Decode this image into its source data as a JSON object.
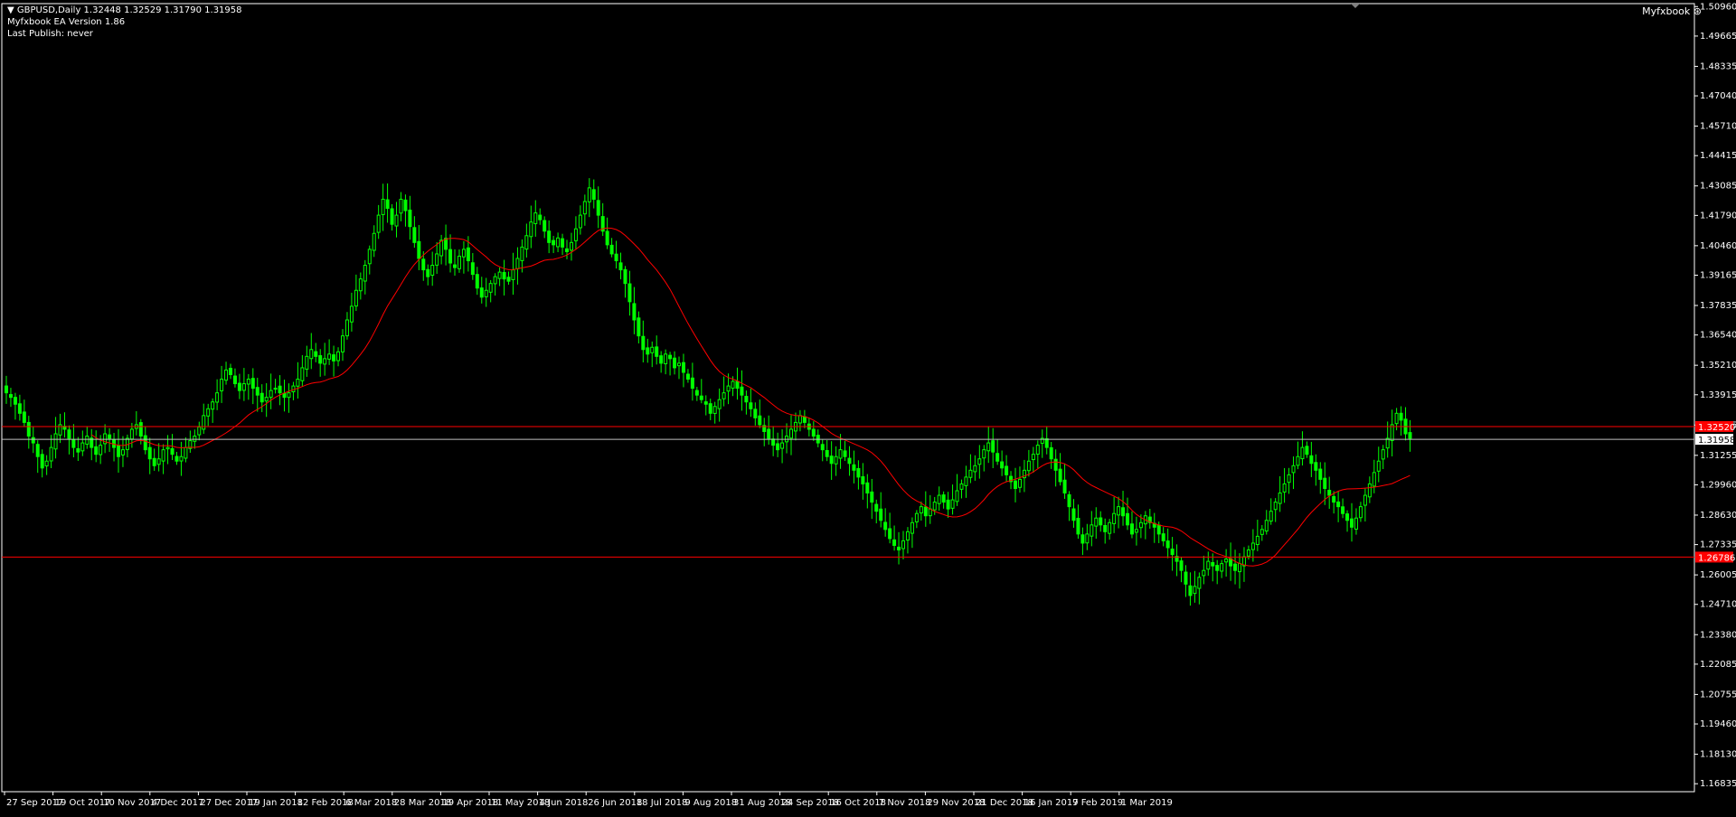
{
  "header": {
    "symbol_line": "GBPUSD,Daily  1.32448 1.32529 1.31790 1.31958",
    "ea_version": "Myfxbook EA Version 1.86",
    "last_publish": "Last Publish: never",
    "brand": "Myfxbook"
  },
  "colors": {
    "background": "#000000",
    "bull_candle": "#00ff00",
    "bear_candle": "#00ff00",
    "moving_average": "#ff0000",
    "level_line": "#ff0000",
    "bid_line": "#c0c0c0",
    "axis": "#ffffff"
  },
  "chart_data": {
    "type": "candlestick",
    "symbol": "GBPUSD",
    "timeframe": "Daily",
    "last": {
      "open": 1.32448,
      "high": 1.32529,
      "low": 1.3179,
      "close": 1.31958
    },
    "ylim": [
      1.16485,
      1.5109
    ],
    "price_ticks": [
      "1.50960",
      "1.49665",
      "1.48335",
      "1.47040",
      "1.45710",
      "1.44415",
      "1.43085",
      "1.41790",
      "1.40460",
      "1.39165",
      "1.37835",
      "1.36540",
      "1.35210",
      "1.33915",
      "1.32585",
      "1.31255",
      "1.29960",
      "1.28630",
      "1.27335",
      "1.26005",
      "1.24710",
      "1.23380",
      "1.22085",
      "1.20755",
      "1.19460",
      "1.18130",
      "1.16835"
    ],
    "date_ticks": [
      "27 Sep 2017",
      "19 Oct 2017",
      "10 Nov 2017",
      "4 Dec 2017",
      "27 Dec 2017",
      "19 Jan 2018",
      "12 Feb 2018",
      "6 Mar 2018",
      "28 Mar 2018",
      "19 Apr 2018",
      "11 May 2018",
      "4 Jun 2018",
      "26 Jun 2018",
      "18 Jul 2018",
      "9 Aug 2018",
      "31 Aug 2018",
      "24 Sep 2018",
      "16 Oct 2018",
      "7 Nov 2018",
      "29 Nov 2018",
      "21 Dec 2018",
      "16 Jan 2019",
      "7 Feb 2019",
      "1 Mar 2019"
    ],
    "levels": [
      {
        "price": 1.3252,
        "label": "1.32520",
        "color": "#ff0000"
      },
      {
        "price": 1.26786,
        "label": "1.26786",
        "color": "#ff0000"
      }
    ],
    "bid": {
      "price": 1.31958,
      "label": "1.31958"
    },
    "closes": [
      1.34,
      1.338,
      1.335,
      1.331,
      1.327,
      1.321,
      1.318,
      1.312,
      1.307,
      1.31,
      1.316,
      1.322,
      1.326,
      1.324,
      1.32,
      1.316,
      1.314,
      1.318,
      1.321,
      1.316,
      1.313,
      1.317,
      1.322,
      1.32,
      1.316,
      1.312,
      1.315,
      1.32,
      1.324,
      1.326,
      1.321,
      1.315,
      1.311,
      1.308,
      1.311,
      1.315,
      1.316,
      1.313,
      1.31,
      1.312,
      1.316,
      1.319,
      1.321,
      1.325,
      1.33,
      1.333,
      1.336,
      1.34,
      1.346,
      1.35,
      1.348,
      1.344,
      1.341,
      1.344,
      1.346,
      1.342,
      1.339,
      1.336,
      1.338,
      1.341,
      1.342,
      1.34,
      1.338,
      1.34,
      1.343,
      1.346,
      1.351,
      1.356,
      1.359,
      1.356,
      1.353,
      1.355,
      1.357,
      1.354,
      1.358,
      1.365,
      1.372,
      1.378,
      1.385,
      1.39,
      1.396,
      1.403,
      1.41,
      1.418,
      1.425,
      1.421,
      1.414,
      1.418,
      1.425,
      1.42,
      1.413,
      1.406,
      1.399,
      1.394,
      1.391,
      1.396,
      1.401,
      1.407,
      1.403,
      1.397,
      1.395,
      1.4,
      1.403,
      1.398,
      1.392,
      1.386,
      1.382,
      1.385,
      1.388,
      1.391,
      1.393,
      1.39,
      1.389,
      1.394,
      1.399,
      1.404,
      1.409,
      1.415,
      1.419,
      1.416,
      1.411,
      1.406,
      1.405,
      1.408,
      1.404,
      1.402,
      1.406,
      1.412,
      1.418,
      1.424,
      1.43,
      1.425,
      1.418,
      1.411,
      1.405,
      1.401,
      1.398,
      1.394,
      1.388,
      1.38,
      1.372,
      1.365,
      1.359,
      1.357,
      1.36,
      1.356,
      1.353,
      1.357,
      1.355,
      1.351,
      1.353,
      1.349,
      1.346,
      1.342,
      1.339,
      1.337,
      1.335,
      1.331,
      1.334,
      1.337,
      1.34,
      1.343,
      1.345,
      1.342,
      1.339,
      1.336,
      1.333,
      1.329,
      1.326,
      1.323,
      1.32,
      1.317,
      1.315,
      1.318,
      1.321,
      1.324,
      1.327,
      1.33,
      1.327,
      1.324,
      1.321,
      1.318,
      1.315,
      1.312,
      1.309,
      1.312,
      1.315,
      1.312,
      1.309,
      1.306,
      1.303,
      1.3,
      1.296,
      1.292,
      1.288,
      1.284,
      1.28,
      1.276,
      1.273,
      1.271,
      1.275,
      1.279,
      1.283,
      1.287,
      1.29,
      1.286,
      1.289,
      1.292,
      1.295,
      1.292,
      1.289,
      1.293,
      1.297,
      1.3,
      1.303,
      1.306,
      1.308,
      1.311,
      1.315,
      1.318,
      1.314,
      1.31,
      1.307,
      1.304,
      1.301,
      1.298,
      1.302,
      1.306,
      1.31,
      1.313,
      1.317,
      1.32,
      1.316,
      1.311,
      1.306,
      1.301,
      1.296,
      1.29,
      1.284,
      1.278,
      1.274,
      1.278,
      1.282,
      1.285,
      1.282,
      1.279,
      1.283,
      1.287,
      1.29,
      1.286,
      1.282,
      1.278,
      1.28,
      1.283,
      1.286,
      1.283,
      1.281,
      1.278,
      1.275,
      1.272,
      1.269,
      1.266,
      1.262,
      1.256,
      1.251,
      1.255,
      1.259,
      1.262,
      1.266,
      1.264,
      1.262,
      1.265,
      1.267,
      1.264,
      1.262,
      1.265,
      1.268,
      1.271,
      1.274,
      1.277,
      1.28,
      1.284,
      1.288,
      1.292,
      1.296,
      1.3,
      1.304,
      1.308,
      1.312,
      1.316,
      1.313,
      1.309,
      1.306,
      1.302,
      1.298,
      1.295,
      1.292,
      1.29,
      1.287,
      1.284,
      1.281,
      1.285,
      1.29,
      1.295,
      1.3,
      1.305,
      1.31,
      1.315,
      1.32,
      1.326,
      1.331,
      1.328,
      1.322,
      1.32
    ],
    "ma_period": 20
  }
}
